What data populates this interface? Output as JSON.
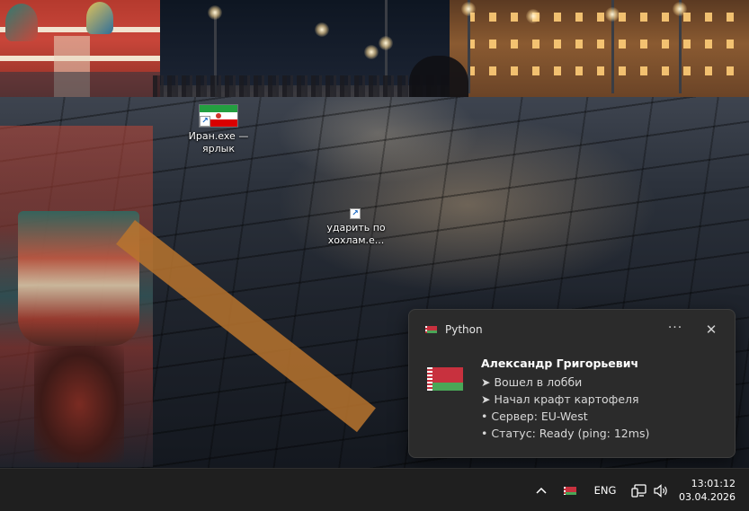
{
  "desktop": {
    "icons": [
      {
        "label": "Иран.exe — ярлык",
        "icon": "iran-flag-icon"
      },
      {
        "label": "ударить по хохлам.e...",
        "icon": "blank-file-icon"
      }
    ]
  },
  "notification": {
    "app_name": "Python",
    "app_icon": "belarus-flag-icon",
    "more_label": "···",
    "close_label": "✕",
    "title": "Александр Григорьевич",
    "lines": [
      "➤ Вошел в лобби",
      "➤ Начал крафт картофеля",
      "• Сервер: EU-West",
      "• Статус: Ready (ping: 12ms)"
    ]
  },
  "taskbar": {
    "chevron_icon": "chevron-up-icon",
    "tray_flag_icon": "belarus-flag-icon",
    "language": "ENG",
    "network_icon": "network-icon",
    "volume_icon": "volume-icon",
    "time": "13:01:12",
    "date": "03.04.2026"
  },
  "colors": {
    "taskbar_bg": "#1f1f1f",
    "toast_bg": "#2b2b2b",
    "belarus_red": "#c8313e",
    "belarus_green": "#4aa657",
    "iran_green": "#239f40",
    "iran_red": "#da0000"
  }
}
